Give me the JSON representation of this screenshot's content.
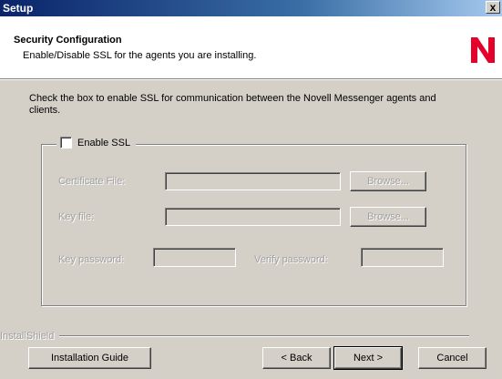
{
  "window": {
    "title": "Setup",
    "close_symbol": "x"
  },
  "header": {
    "title": "Security Configuration",
    "subtitle": "Enable/Disable SSL for the agents you are installing.",
    "logo_letter": "N",
    "logo_color": "#e4002b"
  },
  "description": "Check the box to enable SSL for communication between the Novell Messenger agents and clients.",
  "ssl_group": {
    "checkbox_label": "Enable SSL",
    "checked": false,
    "certificate_label": "Certificate File:",
    "certificate_value": "",
    "certificate_browse": "Browse...",
    "key_file_label": "Key file:",
    "key_file_value": "",
    "key_file_browse": "Browse...",
    "key_password_label": "Key password:",
    "key_password_value": "",
    "verify_password_label": "Verify password:",
    "verify_password_value": ""
  },
  "footer": {
    "brand": "InstallShield",
    "guide_button": "Installation Guide",
    "back_button": "< Back",
    "next_button": "Next >",
    "cancel_button": "Cancel"
  }
}
